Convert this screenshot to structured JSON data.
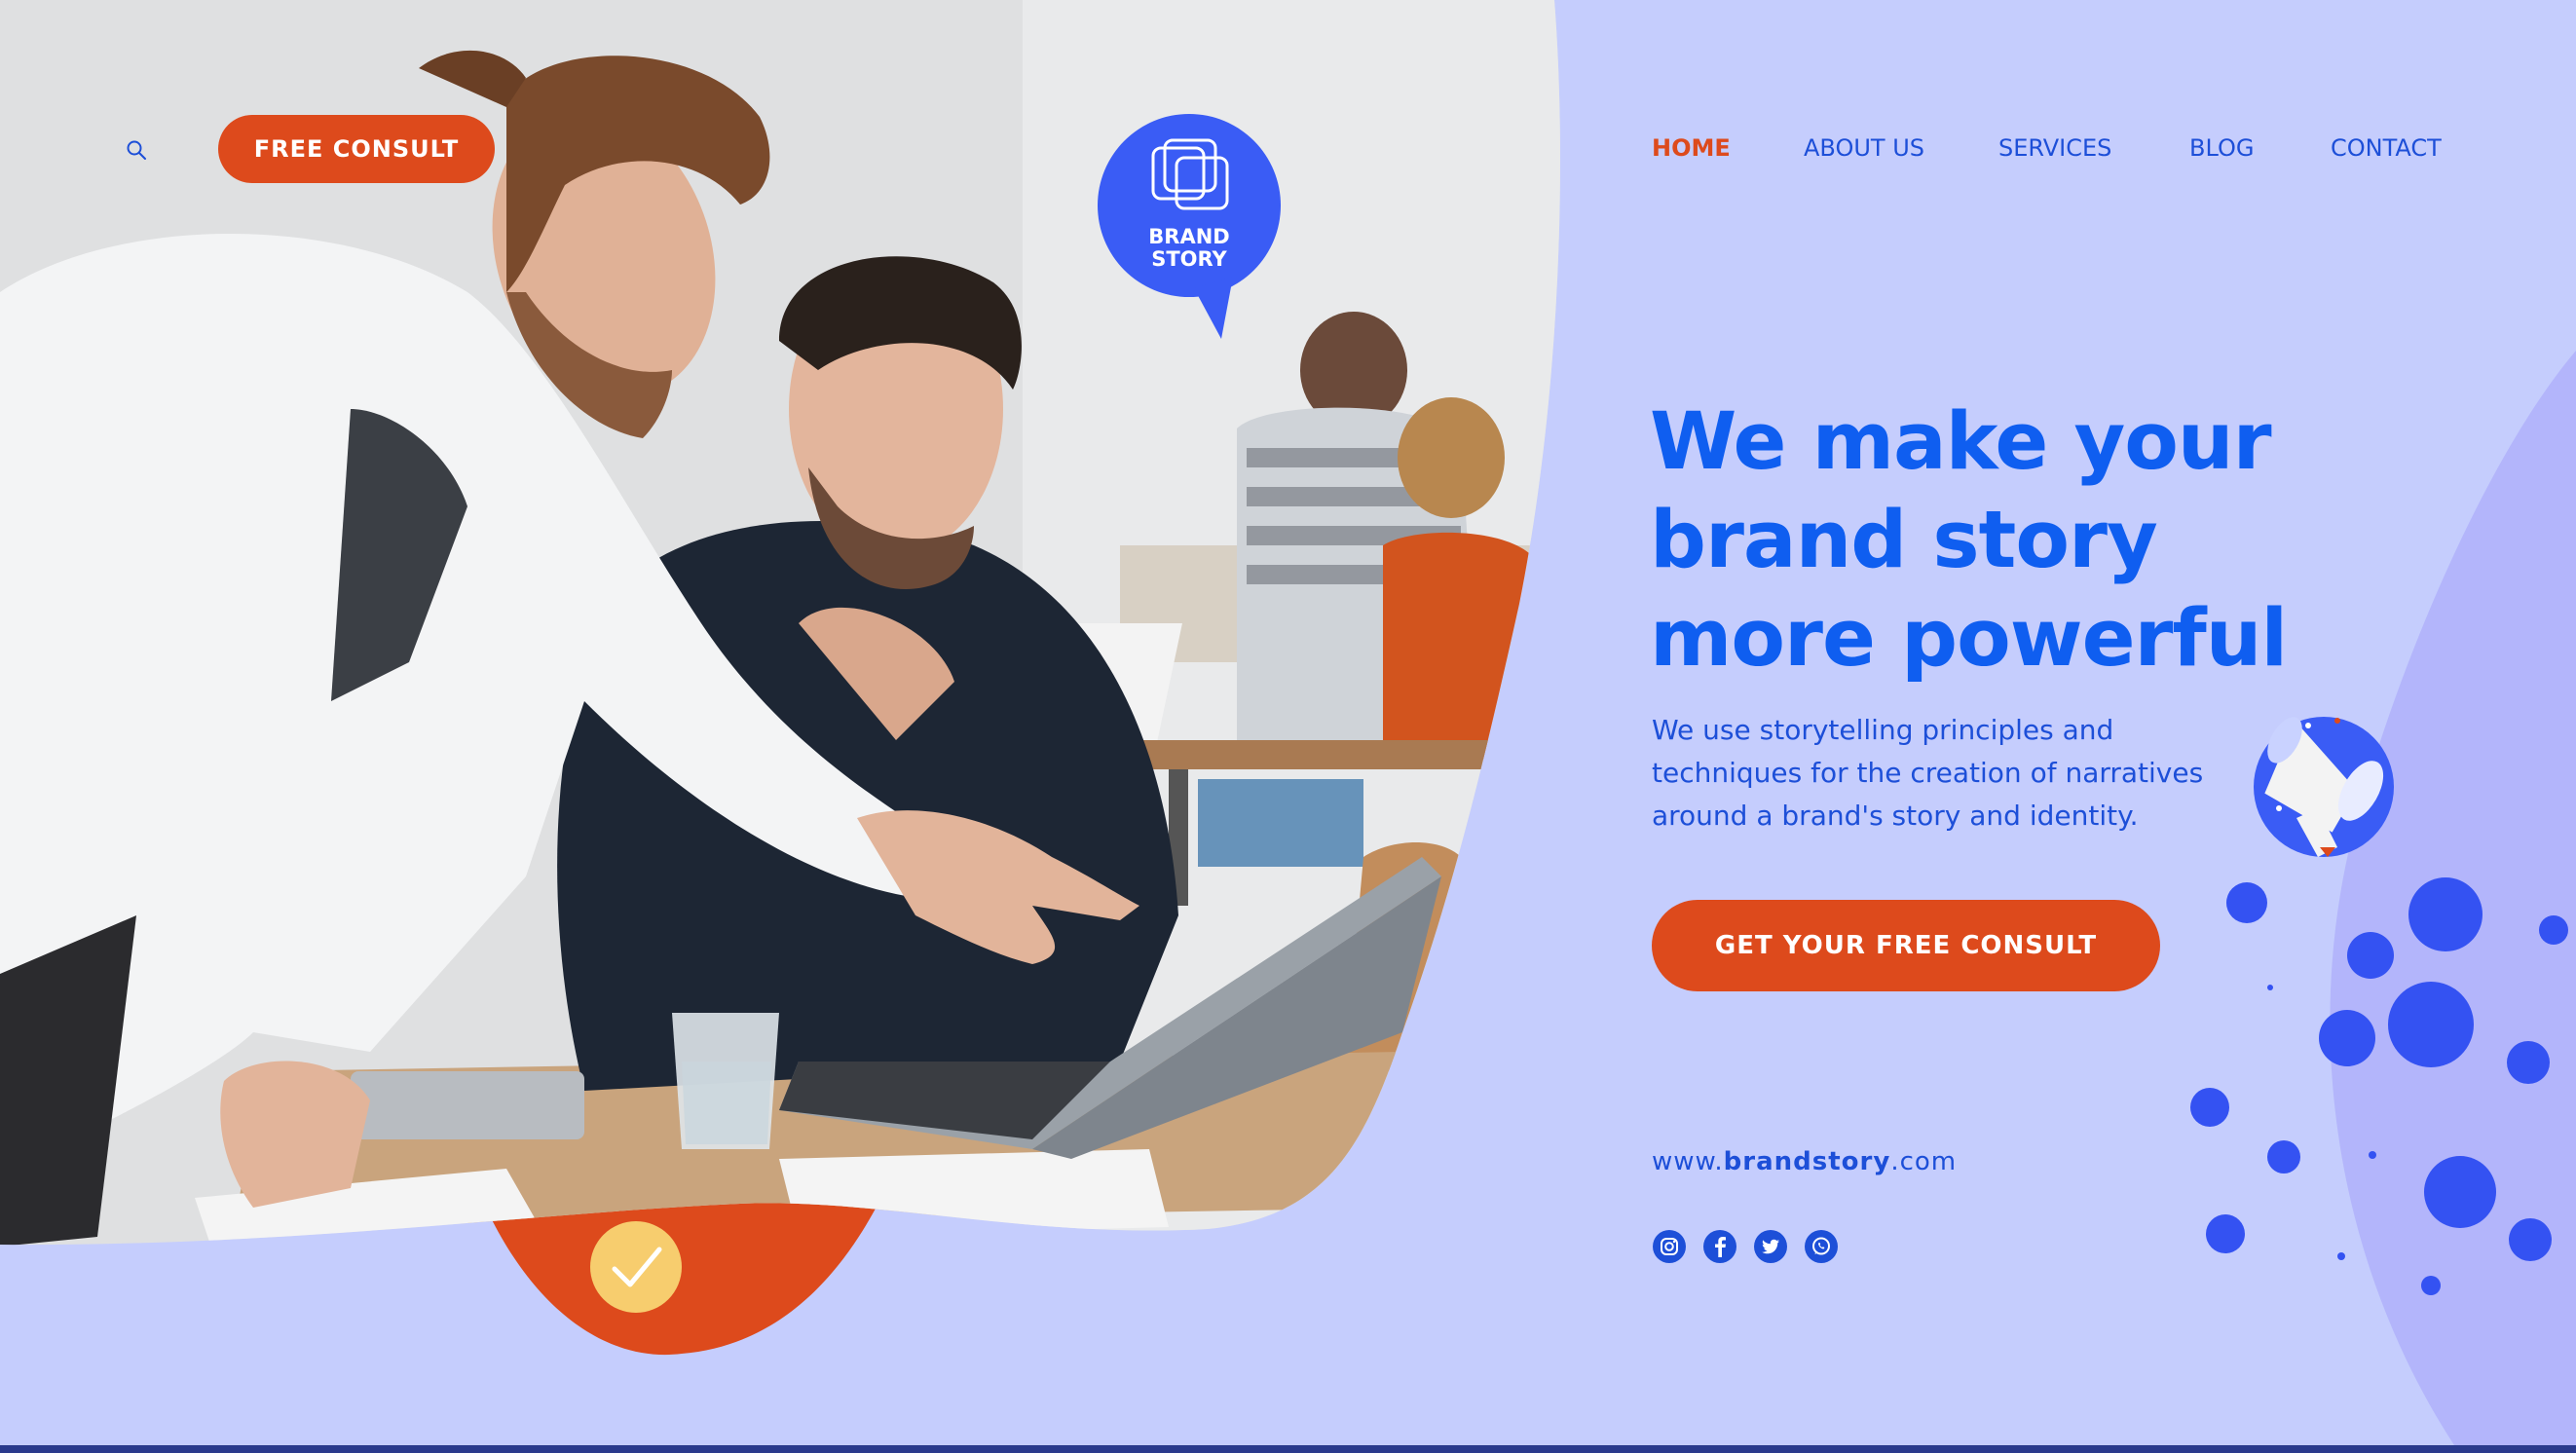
{
  "header": {
    "search_icon": "search-icon",
    "free_consult_label": "FREE CONSULT"
  },
  "brand_badge": {
    "line1": "BRAND",
    "line2": "STORY"
  },
  "nav": {
    "items": [
      {
        "label": "HOME",
        "active": true
      },
      {
        "label": "ABOUT US",
        "active": false
      },
      {
        "label": "SERVICES",
        "active": false
      },
      {
        "label": "BLOG",
        "active": false
      },
      {
        "label": "CONTACT",
        "active": false
      }
    ]
  },
  "hero": {
    "title_line1": "We make your",
    "title_line2": "brand story",
    "title_line3": "more powerful",
    "desc_line1": "We use storytelling principles and",
    "desc_line2": "techniques for the creation of narratives",
    "desc_line3": "around a brand's story and identity.",
    "cta_label": "GET YOUR FREE CONSULT"
  },
  "footer": {
    "website_prefix": "www.",
    "website_bold": "brandstory",
    "website_suffix": ".com",
    "social": [
      "instagram-icon",
      "facebook-icon",
      "twitter-icon",
      "whatsapp-icon"
    ]
  },
  "colors": {
    "background": "#c5cdfd",
    "accent_orange": "#dd4a1c",
    "brand_blue": "#0f5ef0",
    "badge_blue": "#3a5cf5",
    "check_yellow": "#f7cd6e"
  }
}
